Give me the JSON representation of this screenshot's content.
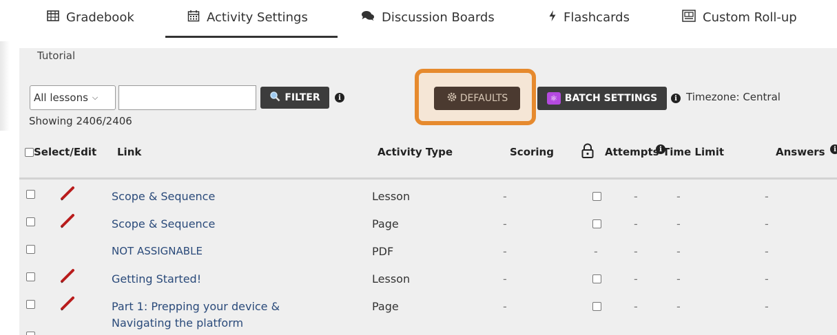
{
  "tabs": [
    {
      "label": "Gradebook",
      "icon": "table-icon"
    },
    {
      "label": "Activity Settings",
      "icon": "calendar-icon"
    },
    {
      "label": "Discussion Boards",
      "icon": "chat-icon"
    },
    {
      "label": "Flashcards",
      "icon": "bolt-icon"
    },
    {
      "label": "Custom Roll-up",
      "icon": "rollup-icon"
    }
  ],
  "breadcrumb": "Tutorial",
  "filter": {
    "lesson_select": "All lessons",
    "filter_input_value": "",
    "filter_button": "FILTER",
    "showing": "Showing 2406/2406"
  },
  "defaults_button": "DEFAULTS",
  "batch_button": "BATCH SETTINGS",
  "timezone": "Timezone: Central",
  "colors": {
    "accent_orange": "#e68a2e",
    "dark_button": "#3c3c3c",
    "defaults_button": "#4b3a30",
    "link": "#2a4a7a",
    "batch_icon": "#b44ae0"
  },
  "columns": {
    "select": "Select/Edit",
    "link": "Link",
    "activity_type": "Activity Type",
    "scoring": "Scoring",
    "attempts": "Attempts",
    "time_limit": "Time Limit",
    "answers": "Answers"
  },
  "rows": [
    {
      "link": [
        "Scope & Sequence"
      ],
      "type": "Lesson",
      "scoring": "-",
      "locked": false,
      "attempts": "-",
      "time_limit": "-",
      "answers": "-",
      "editable": true
    },
    {
      "link": [
        "Scope & Sequence"
      ],
      "type": "Page",
      "scoring": "-",
      "locked": false,
      "attempts": "-",
      "time_limit": "-",
      "answers": "-",
      "editable": true
    },
    {
      "link": [
        "NOT ASSIGNABLE"
      ],
      "type": "PDF",
      "scoring": "-",
      "lock": "-",
      "attempts": "-",
      "time_limit": "-",
      "answers": "-",
      "editable": false
    },
    {
      "link": [
        "Getting Started!"
      ],
      "type": "Lesson",
      "scoring": "-",
      "locked": false,
      "attempts": "-",
      "time_limit": "-",
      "answers": "-",
      "editable": true
    },
    {
      "link": [
        "Part 1: Prepping your device &",
        "Navigating the platform"
      ],
      "type": "Page",
      "scoring": "-",
      "locked": false,
      "attempts": "-",
      "time_limit": "-",
      "answers": "-",
      "editable": true
    }
  ]
}
